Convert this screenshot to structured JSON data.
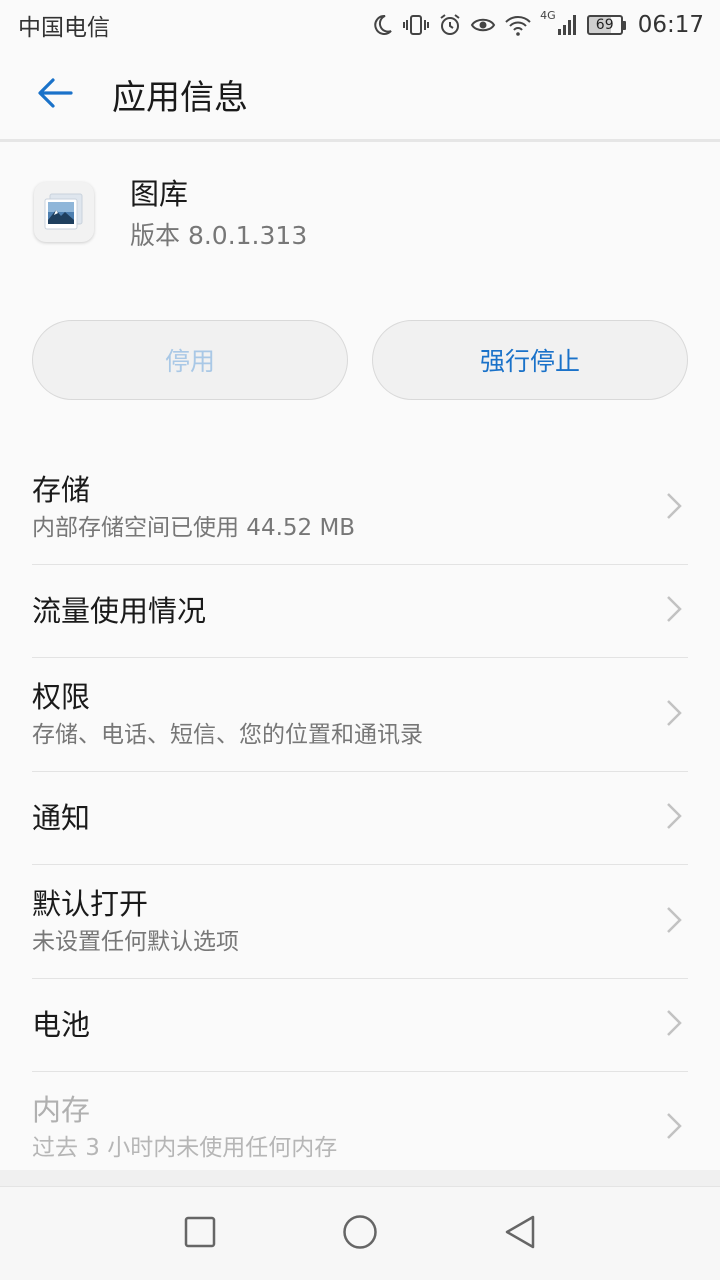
{
  "status_bar": {
    "carrier": "中国电信",
    "network_label": "4G",
    "battery_level": "69",
    "time": "06:17"
  },
  "app_bar": {
    "title": "应用信息",
    "back_icon": "arrow-left-icon"
  },
  "app": {
    "name": "图库",
    "version": "版本 8.0.1.313",
    "icon": "gallery-icon"
  },
  "actions": {
    "disable_label": "停用",
    "force_stop_label": "强行停止"
  },
  "settings": {
    "items": [
      {
        "title": "存储",
        "subtitle": "内部存储空间已使用 44.52 MB"
      },
      {
        "title": "流量使用情况",
        "subtitle": ""
      },
      {
        "title": "权限",
        "subtitle": "存储、电话、短信、您的位置和通讯录"
      },
      {
        "title": "通知",
        "subtitle": ""
      },
      {
        "title": "默认打开",
        "subtitle": "未设置任何默认选项"
      },
      {
        "title": "电池",
        "subtitle": ""
      },
      {
        "title": "内存",
        "subtitle": "过去 3 小时内未使用任何内存"
      }
    ]
  },
  "colors": {
    "accent": "#1a72c9",
    "disabled_accent": "#a9c8e6",
    "background": "#fafafa",
    "divider": "#e3e3e3"
  },
  "nav_bar": {
    "recent_icon": "square-icon",
    "home_icon": "circle-icon",
    "back_icon": "triangle-back-icon"
  }
}
